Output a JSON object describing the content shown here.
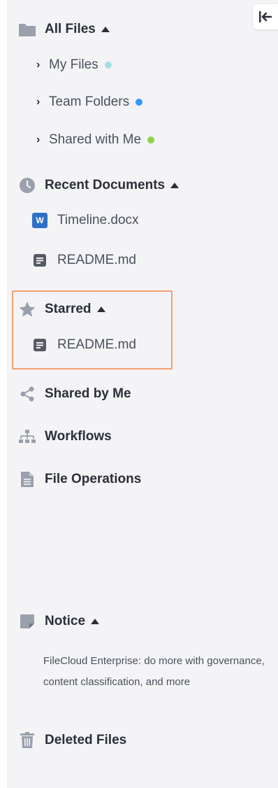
{
  "sections": {
    "all_files": {
      "title": "All Files",
      "items": [
        {
          "label": "My Files",
          "dot_color": "#a6e0e4"
        },
        {
          "label": "Team Folders",
          "dot_color": "#3399ff"
        },
        {
          "label": "Shared with Me",
          "dot_color": "#8fd14f"
        }
      ]
    },
    "recent": {
      "title": "Recent Documents",
      "items": [
        {
          "label": "Timeline.docx",
          "icon": "word-doc-icon"
        },
        {
          "label": "README.md",
          "icon": "text-doc-icon"
        }
      ]
    },
    "starred": {
      "title": "Starred",
      "items": [
        {
          "label": "README.md",
          "icon": "text-doc-icon"
        }
      ]
    },
    "shared_by_me": {
      "title": "Shared by Me"
    },
    "workflows": {
      "title": "Workflows"
    },
    "file_operations": {
      "title": "File Operations"
    },
    "notice": {
      "title": "Notice",
      "text": "FileCloud Enterprise: do more with governance, content classification, and more"
    },
    "deleted_files": {
      "title": "Deleted Files"
    }
  },
  "word_icon_letter": "W",
  "colors": {
    "icon_gray": "#9aa0ad",
    "highlight_border": "#f3a070",
    "word_blue": "#2f6fc6"
  }
}
